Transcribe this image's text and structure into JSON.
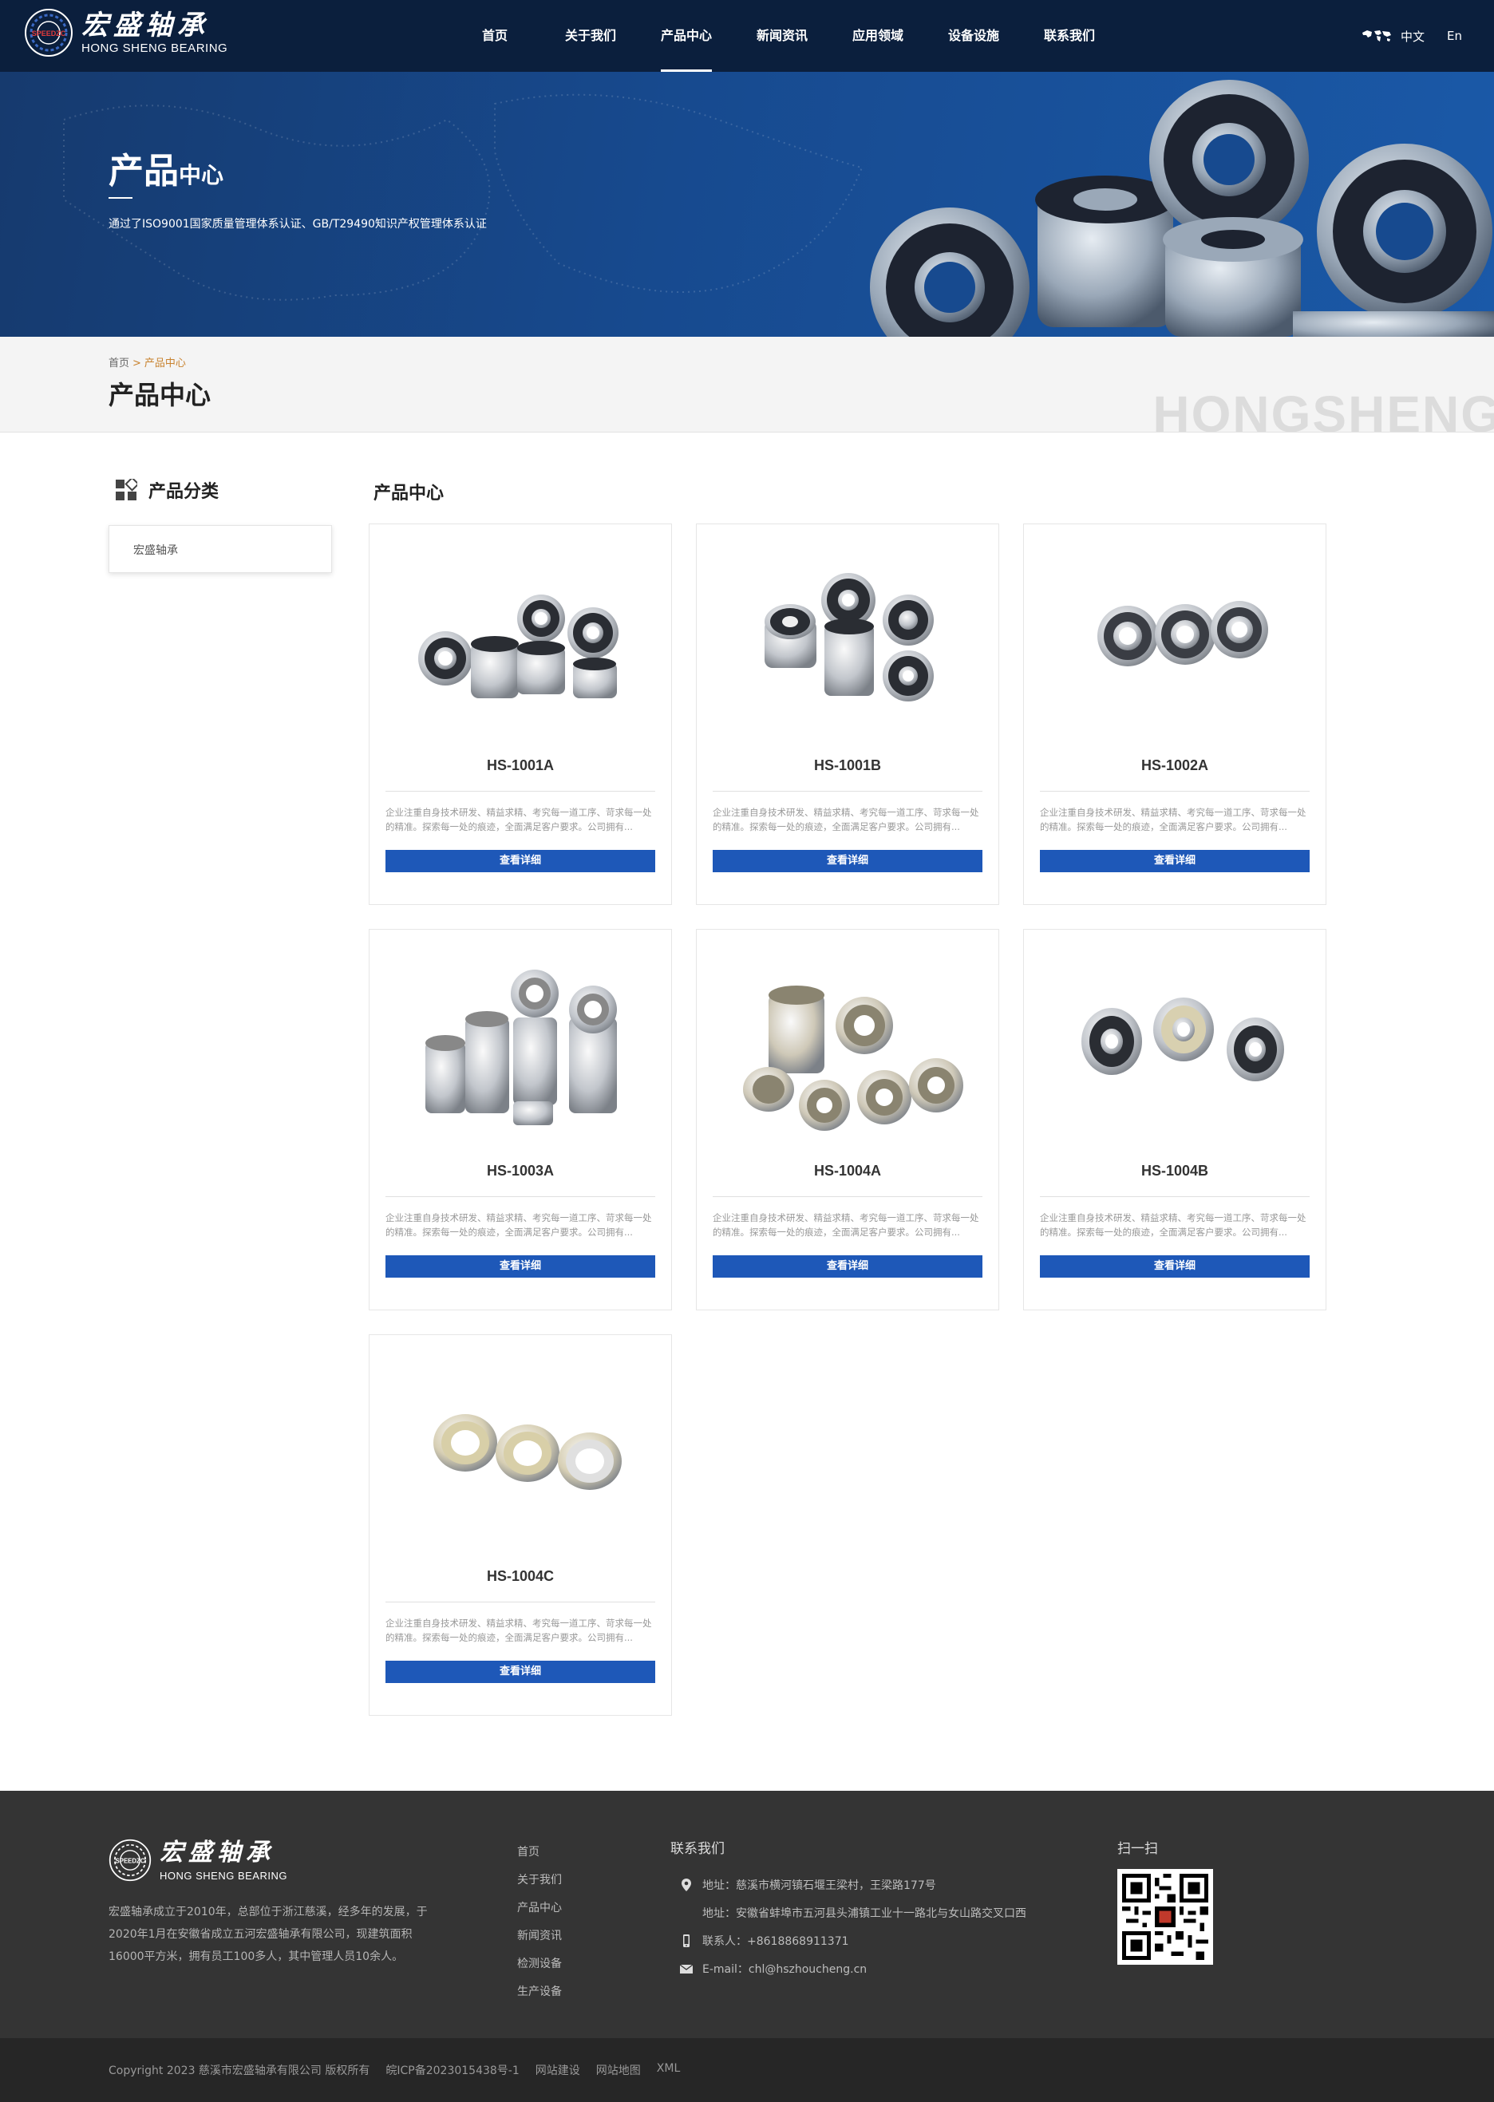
{
  "brand": {
    "name_cn": "宏盛轴承",
    "name_en": "HONG SHENG BEARING",
    "badge": "SPEEDZC"
  },
  "nav": {
    "items": [
      {
        "label": "首页",
        "active": false
      },
      {
        "label": "关于我们",
        "active": false
      },
      {
        "label": "产品中心",
        "active": true
      },
      {
        "label": "新闻资讯",
        "active": false
      },
      {
        "label": "应用领域",
        "active": false
      },
      {
        "label": "设备设施",
        "active": false
      },
      {
        "label": "联系我们",
        "active": false
      }
    ],
    "lang_cn": "中文",
    "lang_en": "En"
  },
  "banner": {
    "title_big": "产品",
    "title_small": "中心",
    "subtitle": "通过了ISO9001国家质量管理体系认证、GB/T29490知识产权管理体系认证"
  },
  "breadcrumb": {
    "home": "首页",
    "sep": ">",
    "current": "产品中心",
    "page_title": "产品中心",
    "watermark": "HONGSHENG"
  },
  "sidebar": {
    "heading": "产品分类",
    "items": [
      {
        "label": "宏盛轴承"
      }
    ]
  },
  "main": {
    "heading": "产品中心",
    "button_label": "查看详细",
    "products": [
      {
        "name": "HS-1001A",
        "desc": "企业注重自身技术研发、精益求精、考究每一道工序、苛求每一处的精准。探索每一处的痕迹，全面满足客户要求。公司拥有..."
      },
      {
        "name": "HS-1001B",
        "desc": "企业注重自身技术研发、精益求精、考究每一道工序、苛求每一处的精准。探索每一处的痕迹，全面满足客户要求。公司拥有..."
      },
      {
        "name": "HS-1002A",
        "desc": "企业注重自身技术研发、精益求精、考究每一道工序、苛求每一处的精准。探索每一处的痕迹，全面满足客户要求。公司拥有..."
      },
      {
        "name": "HS-1003A",
        "desc": "企业注重自身技术研发、精益求精、考究每一道工序、苛求每一处的精准。探索每一处的痕迹，全面满足客户要求。公司拥有..."
      },
      {
        "name": "HS-1004A",
        "desc": "企业注重自身技术研发、精益求精、考究每一道工序、苛求每一处的精准。探索每一处的痕迹，全面满足客户要求。公司拥有..."
      },
      {
        "name": "HS-1004B",
        "desc": "企业注重自身技术研发、精益求精、考究每一道工序、苛求每一处的精准。探索每一处的痕迹，全面满足客户要求。公司拥有..."
      },
      {
        "name": "HS-1004C",
        "desc": "企业注重自身技术研发、精益求精、考究每一道工序、苛求每一处的精准。探索每一处的痕迹，全面满足客户要求。公司拥有..."
      }
    ]
  },
  "footer": {
    "about": "宏盛轴承成立于2010年，总部位于浙江慈溪，经多年的发展，于2020年1月在安徽省成立五河宏盛轴承有限公司，现建筑面积16000平方米，拥有员工100多人，其中管理人员10余人。",
    "links": [
      "首页",
      "关于我们",
      "产品中心",
      "新闻资讯",
      "检测设备",
      "生产设备"
    ],
    "contact_title": "联系我们",
    "address1": "地址：慈溪市横河镇石堰王梁村，王梁路177号",
    "address2": "地址：安徽省蚌埠市五河县头浦镇工业十一路北与女山路交叉口西",
    "phone": "联系人：+8618868911371",
    "email": "E-mail：chl@hszhoucheng.cn",
    "scan_title": "扫一扫"
  },
  "copyright": {
    "text": "Copyright 2023  慈溪市宏盛轴承有限公司  版权所有",
    "icp": "皖ICP备2023015438号-1",
    "build": "网站建设",
    "sitemap": "网站地图",
    "xml": "XML"
  },
  "colors": {
    "header_bg": "#0b1f3d",
    "banner_blue": "#174a8f",
    "button_blue": "#1e58b8",
    "crumb_accent": "#c8822e",
    "footer_bg": "#343434"
  }
}
